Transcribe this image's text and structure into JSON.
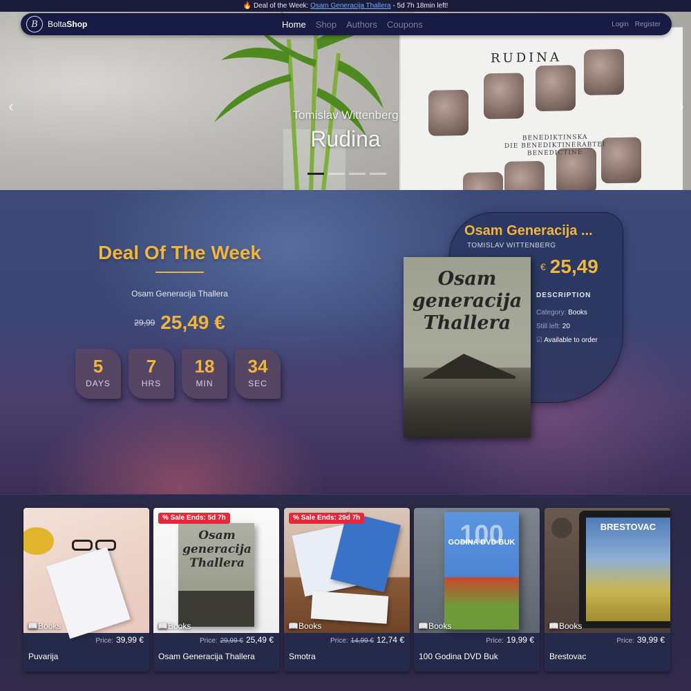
{
  "topbar": {
    "prefix": "Deal of the Week: ",
    "link": "Osam Generacija Thallera",
    "suffix": " - 5d 7h 18min left!"
  },
  "nav": {
    "brand_light": "Bolta",
    "brand_bold": "Shop",
    "links": [
      "Home",
      "Shop",
      "Authors",
      "Coupons"
    ],
    "login": "Login",
    "register": "Register"
  },
  "hero": {
    "author": "Tomislav Wittenberg",
    "title": "Rudina",
    "book_title": "RUDINA",
    "book_sub_1": "BENEDIKTINSKA",
    "book_sub_2": "DIE BENEDIKTINERABTEI",
    "book_sub_3": "BENEDICTINE",
    "prev_icon": "chevron-left-icon",
    "next_icon": "chevron-right-icon"
  },
  "deal": {
    "title": "Deal Of The Week",
    "book": "Osam Generacija Thallera",
    "old_price": "29,99",
    "new_price": "25,49 €",
    "countdown": [
      {
        "value": "5",
        "label": "DAYS"
      },
      {
        "value": "7",
        "label": "HRS"
      },
      {
        "value": "18",
        "label": "MIN"
      },
      {
        "value": "34",
        "label": "SEC"
      }
    ]
  },
  "product": {
    "title": "Osam Generacija ...",
    "author": "TOMISLAV WITTENBERG",
    "currency": "€",
    "price": "25,49",
    "desc_label": "DESCRIPTION",
    "category_label": "Category: ",
    "category": "Books",
    "stock_label": "Still left: ",
    "stock": "20",
    "availability": "Available to order",
    "cover_line1": "Osam",
    "cover_line2": "generacija",
    "cover_line3": "Thallera"
  },
  "cards": [
    {
      "name": "Puvarija",
      "category": "Books",
      "price_label": "Price:",
      "old_price": "",
      "price": "39,99 €",
      "badge": ""
    },
    {
      "name": "Osam Generacija Thallera",
      "category": "Books",
      "price_label": "Price:",
      "old_price": "29,99 €",
      "price": "25,49 €",
      "badge": "% Sale Ends: 5d 7h"
    },
    {
      "name": "Smotra",
      "category": "Books",
      "price_label": "Price:",
      "old_price": "14,99 €",
      "price": "12,74 €",
      "badge": "% Sale Ends: 29d 7h"
    },
    {
      "name": "100 Godina DVD Buk",
      "category": "Books",
      "price_label": "Price:",
      "old_price": "",
      "price": "19,99 €",
      "badge": ""
    },
    {
      "name": "Brestovac",
      "category": "Books",
      "price_label": "Price:",
      "old_price": "",
      "price": "39,99 €",
      "badge": ""
    }
  ],
  "card_texts": {
    "c3_cover": "100",
    "c3_title": "GODINA DVD BUK",
    "c4_cover": "BRESTOVAC",
    "c1_cover": "Osam generacija Thallera"
  },
  "colors": {
    "accent": "#f0b53a",
    "navbar": "#171a42",
    "sale_badge": "#e02b3c"
  }
}
